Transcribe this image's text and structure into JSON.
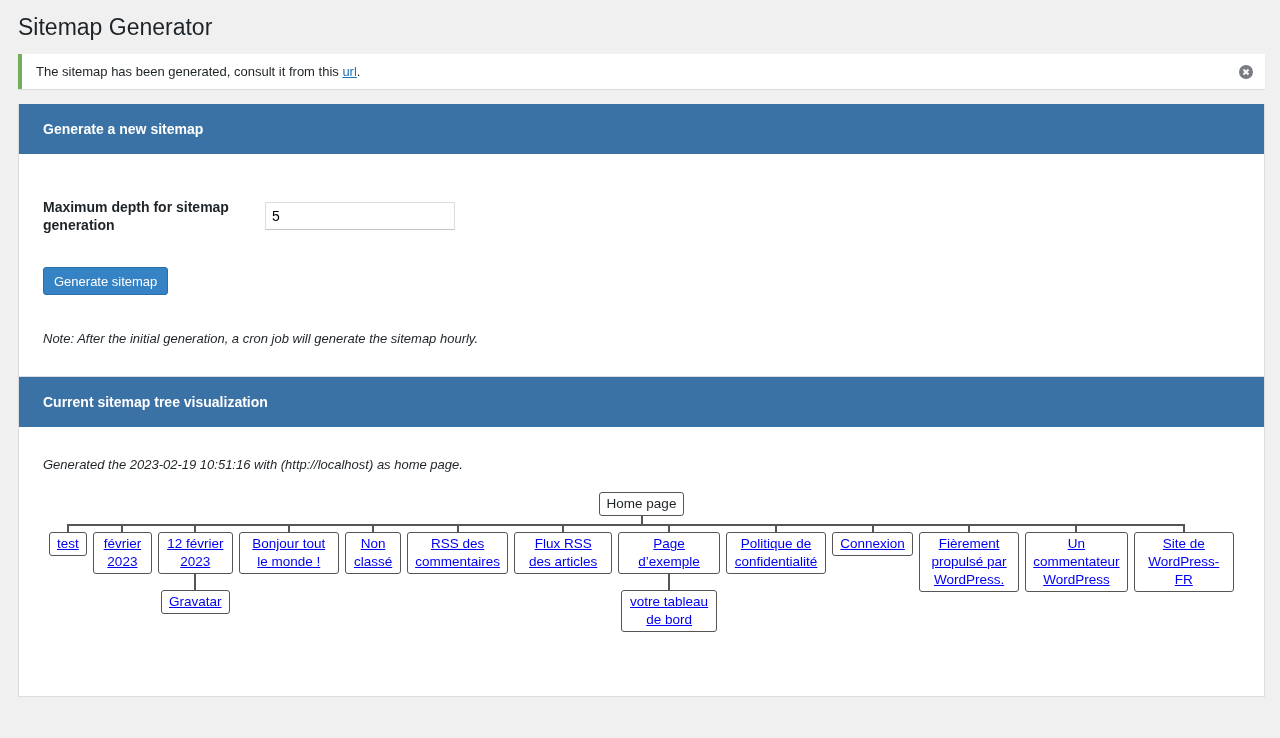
{
  "page_title": "Sitemap Generator",
  "notice": {
    "text_before": "The sitemap has been generated, consult it from this ",
    "link": "url",
    "text_after": "."
  },
  "generate_panel": {
    "title": "Generate a new sitemap",
    "depth_label": "Maximum depth for sitemap generation",
    "depth_value": "5",
    "button": "Generate sitemap",
    "note": "Note: After the initial generation, a cron job will generate the sitemap hourly."
  },
  "tree_panel": {
    "title": "Current sitemap tree visualization",
    "generated_info": "Generated the 2023-02-19 10:51:16 with (http://localhost) as home page.",
    "tree": {
      "label": "Home page",
      "children": [
        {
          "label": "test"
        },
        {
          "label": "février 2023"
        },
        {
          "label": "12 février 2023",
          "children": [
            {
              "label": "Gravatar"
            }
          ]
        },
        {
          "label": "Bonjour tout le monde !"
        },
        {
          "label": "Non classé"
        },
        {
          "label": "RSS des commentaires"
        },
        {
          "label": "Flux RSS des articles"
        },
        {
          "label": "Page d’exemple",
          "children": [
            {
              "label": "votre tableau de bord"
            }
          ]
        },
        {
          "label": "Politique de confidentialité"
        },
        {
          "label": "Connexion"
        },
        {
          "label": "Fièrement propulsé par WordPress."
        },
        {
          "label": "Un commentateur WordPress"
        },
        {
          "label": "Site de WordPress-FR"
        }
      ]
    }
  }
}
